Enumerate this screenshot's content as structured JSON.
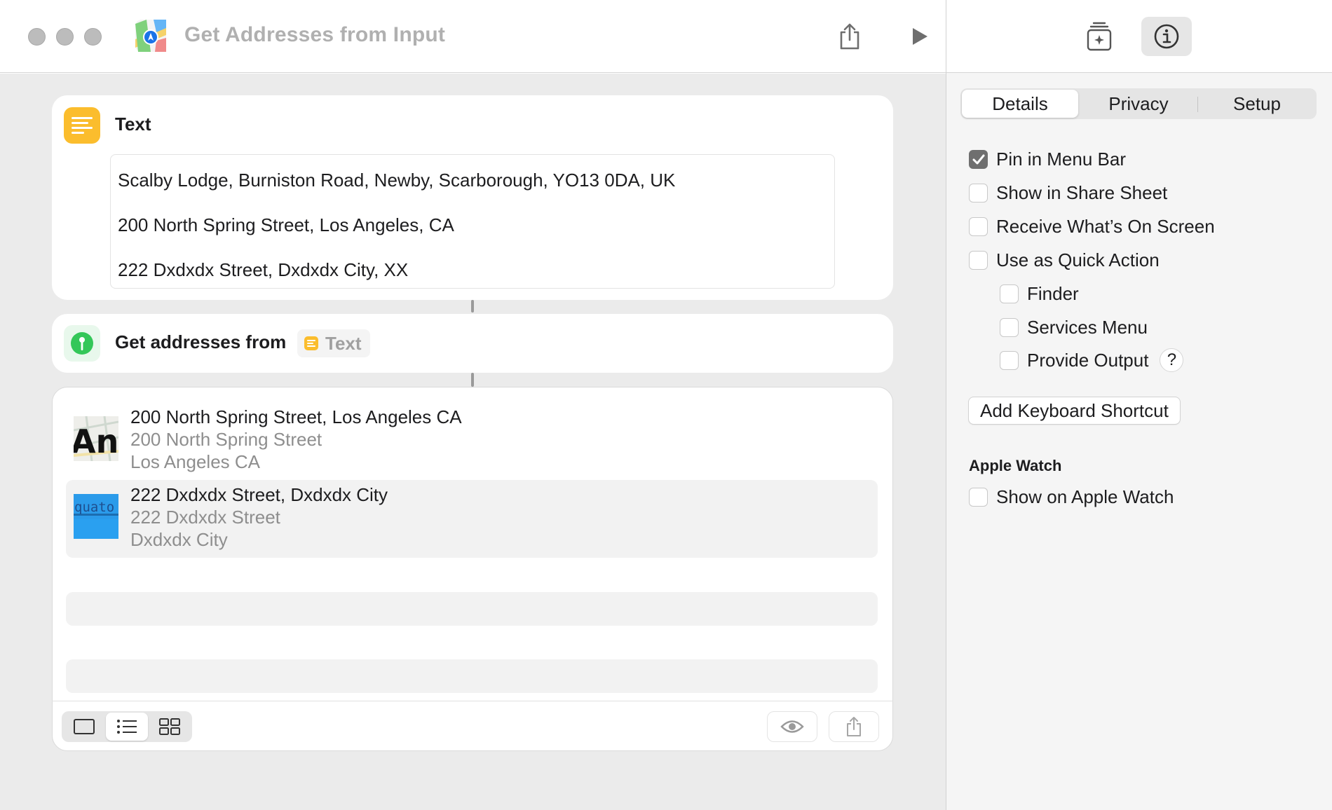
{
  "window": {
    "title": "Get Addresses from Input"
  },
  "toolbar": {
    "share_icon": "share-icon",
    "run_icon": "play-icon",
    "library_icon": "add-to-library-icon",
    "info_icon": "info-icon"
  },
  "text_action": {
    "title": "Text",
    "lines": [
      "Scalby Lodge, Burniston Road, Newby, Scarborough, YO13 0DA, UK",
      "200 North Spring Street, Los Angeles, CA",
      "222 Dxdxdx Street, Dxdxdx City, XX"
    ]
  },
  "address_action": {
    "title": "Get addresses from",
    "token": "Text"
  },
  "results": {
    "items": [
      {
        "title": "200 North Spring Street, Los Angeles CA",
        "line1": "200 North Spring Street",
        "line2": "Los Angeles CA",
        "thumb_text": "Ang"
      },
      {
        "title": "222 Dxdxdx Street, Dxdxdx City",
        "line1": "222 Dxdxdx Street",
        "line2": "Dxdxdx City",
        "thumb_text": "quato"
      }
    ]
  },
  "inspector": {
    "tabs": [
      "Details",
      "Privacy",
      "Setup"
    ],
    "active_tab": "Details",
    "options": [
      {
        "label": "Pin in Menu Bar",
        "checked": true
      },
      {
        "label": "Show in Share Sheet",
        "checked": false
      },
      {
        "label": "Receive What’s On Screen",
        "checked": false
      },
      {
        "label": "Use as Quick Action",
        "checked": false
      }
    ],
    "quick_action_options": [
      {
        "label": "Finder",
        "checked": false
      },
      {
        "label": "Services Menu",
        "checked": false
      },
      {
        "label": "Provide Output",
        "checked": false
      }
    ],
    "help_label": "?",
    "shortcut_button": "Add Keyboard Shortcut",
    "watch_section": "Apple Watch",
    "watch_option": {
      "label": "Show on Apple Watch",
      "checked": false
    }
  },
  "colors": {
    "text_action_icon": "#fbbd2d",
    "maps_action_icon": "#34c759",
    "canvas_bg": "#ebebeb"
  }
}
